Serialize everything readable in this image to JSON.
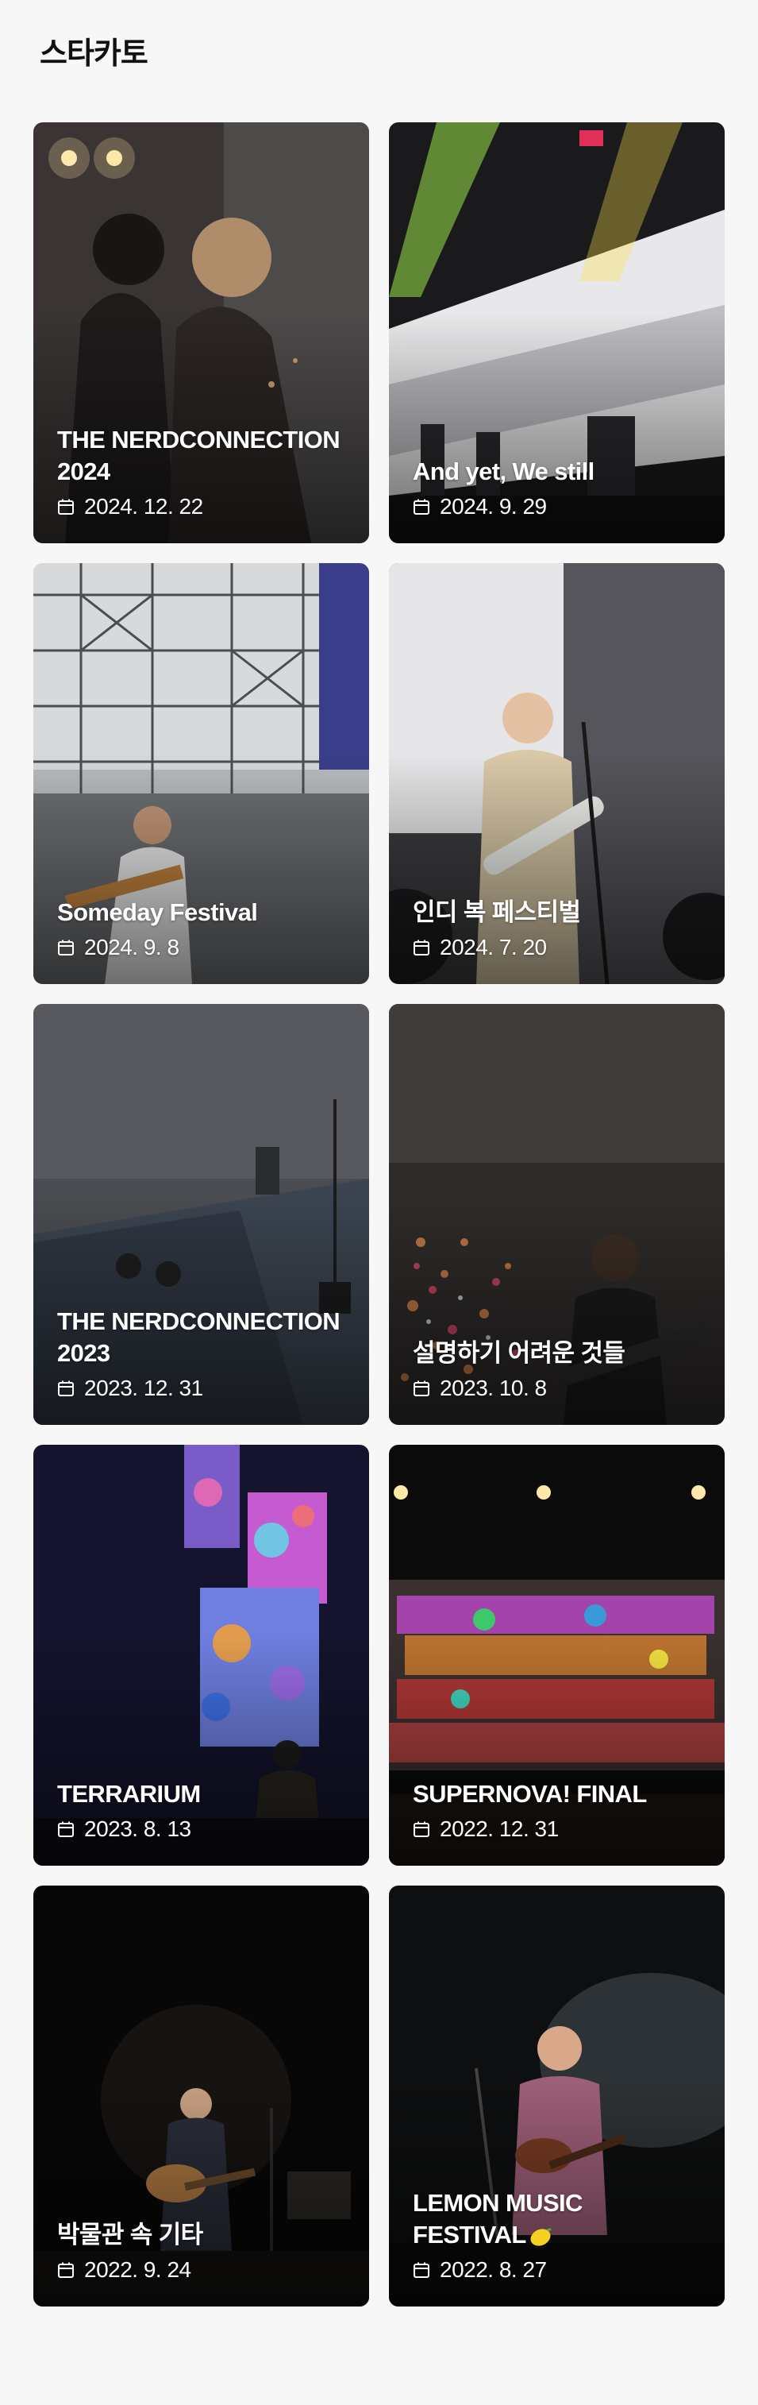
{
  "page": {
    "title": "스타카토"
  },
  "icons": {
    "date": "calendar-icon"
  },
  "cards": [
    {
      "title": "THE NERDCONNECTION 2024",
      "date": "2024. 12. 22"
    },
    {
      "title": "And yet, We still",
      "date": "2024. 9. 29"
    },
    {
      "title": "Someday Festival",
      "date": "2024. 9. 8"
    },
    {
      "title": "인디 복 페스티벌",
      "date": "2024. 7. 20"
    },
    {
      "title": "THE NERDCONNECTION 2023",
      "date": "2023. 12. 31"
    },
    {
      "title": "설명하기 어려운 것들",
      "date": "2023. 10. 8"
    },
    {
      "title": "TERRARIUM",
      "date": "2023. 8. 13"
    },
    {
      "title": "SUPERNOVA! FINAL",
      "date": "2022. 12. 31"
    },
    {
      "title": "박물관 속 기타",
      "date": "2022. 9. 24"
    },
    {
      "title": "LEMON MUSIC FESTIVAL",
      "title_emoji": "lemon-icon",
      "date": "2022. 8. 27"
    }
  ]
}
